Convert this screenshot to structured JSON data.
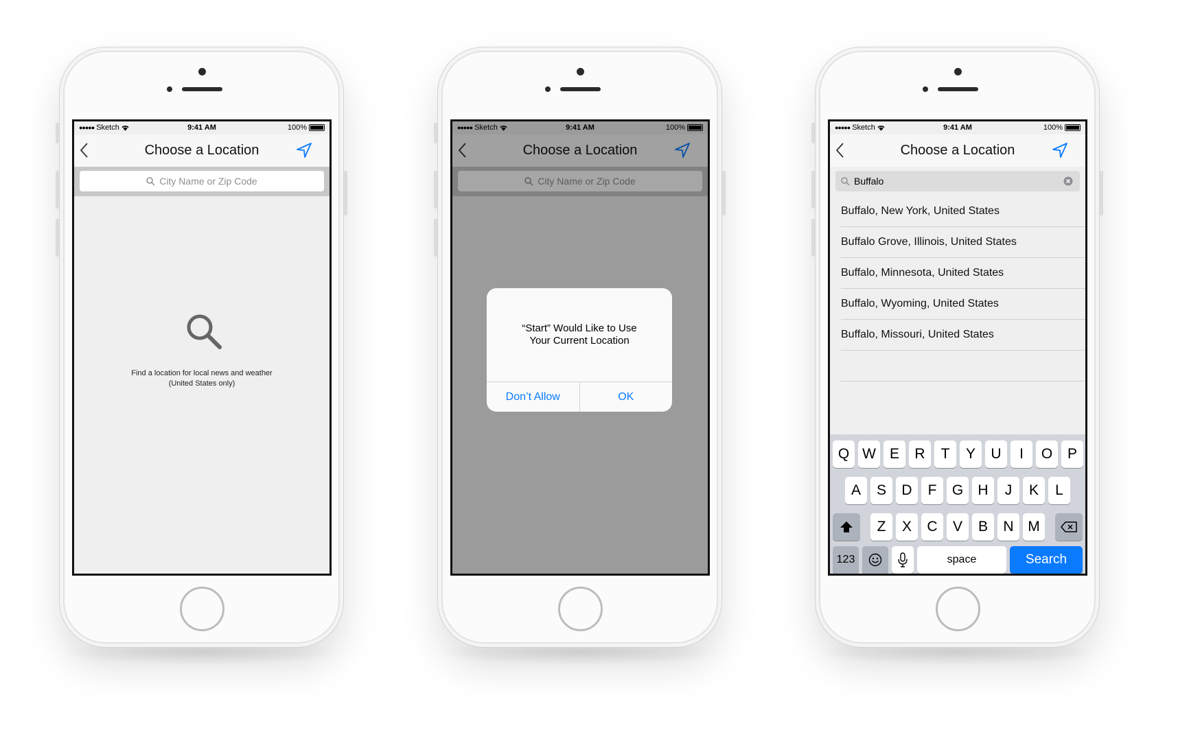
{
  "status_bar": {
    "carrier": "Sketch",
    "signal_dots": "●●●●●",
    "time": "9:41 AM",
    "battery": "100%"
  },
  "nav": {
    "title": "Choose a Location"
  },
  "search": {
    "placeholder": "City Name or Zip Code",
    "query": "Buffalo"
  },
  "empty_state": {
    "line1": "Find a location for local news and weather",
    "line2": "(United States only)"
  },
  "alert": {
    "line1": "“Start” Would Like to Use",
    "line2": "Your Current Location",
    "dont_allow": "Don’t Allow",
    "ok": "OK"
  },
  "results": [
    "Buffalo, New York, United States",
    "Buffalo Grove, Illinois, United States",
    "Buffalo, Minnesota, United States",
    "Buffalo, Wyoming, United States",
    "Buffalo, Missouri, United States"
  ],
  "keyboard": {
    "row1": [
      "Q",
      "W",
      "E",
      "R",
      "T",
      "Y",
      "U",
      "I",
      "O",
      "P"
    ],
    "row2": [
      "A",
      "S",
      "D",
      "F",
      "G",
      "H",
      "J",
      "K",
      "L"
    ],
    "row3": [
      "Z",
      "X",
      "C",
      "V",
      "B",
      "N",
      "M"
    ],
    "numbers_label": "123",
    "space_label": "space",
    "search_label": "Search"
  },
  "colors": {
    "accent_blue": "#0a7aff",
    "dim_overlay": "#9a9a9a",
    "keyboard_bg": "#d1d5db"
  },
  "icons": {
    "back": "chevron-left-icon",
    "location": "location-arrow-icon",
    "search": "magnifier-icon",
    "clear": "clear-circle-icon",
    "shift": "shift-icon",
    "delete": "delete-backspace-icon",
    "emoji": "emoji-icon",
    "mic": "microphone-icon"
  }
}
